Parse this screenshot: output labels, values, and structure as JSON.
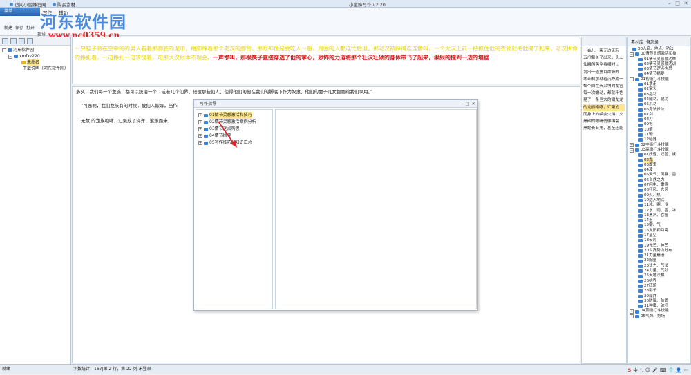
{
  "titlebar": {
    "link1": "访问小蜜蜂官网",
    "link2": "购买素材",
    "app_title": "小蜜蜂写作 v2.20"
  },
  "ribbon": {
    "orb": "菜单",
    "tabs": [
      "写作",
      "辅助"
    ],
    "buttons": [
      "新建",
      "保存",
      "打开",
      "指导"
    ]
  },
  "watermark": {
    "title": "河东软件园",
    "url": "www.pc0359.cn"
  },
  "left_tree": {
    "root": "河东软件园",
    "child": "xmfxz220",
    "items": [
      "未命名",
      "下载说明（河东软件园）"
    ]
  },
  "top_story": {
    "yellow": "一只鞋子悬在空中的的男人看着那脚底的泥印，用脚踩着那个老汉的脚背，那眼神像是要吃人一般，周围的人都连忙后退，那老汉被踩得连连惨叫，一个大汉上前一把抓住他的衣领就把他提了起来，老汉拼命的挣扎着，一边挣扎一边求饶着，可那大汉根本不理会。",
    "red": "一声惨叫，那根筷子直接穿透了他的掌心，恐怖的力道将那个壮汉壮硕的身体带飞了起来，狠狠的撞到一边的墙壁"
  },
  "main_text": [
    "多久，我们每一个龙族，都可以统治一个，或者几个仙界，较役那些仙人，使得他们匍匐在我们的脚底下作为奴隶，他们的妻子儿女都要给我们享用。”",
    "“可恶啊，我们龙族有的时候，被仙人欺辱，当作",
    "无数 的龙族咆哮，汇聚成了海洋，滚滚而来，"
  ],
  "dialog": {
    "title": "写作指导",
    "items": [
      "01情节灵感激活和技巧",
      "02情节灵感激活案例分析",
      "03情节逻点构思",
      "04情节摘要",
      "05写作技巧和知识汇总"
    ]
  },
  "right_text": [
    "一会儿一柴无边无际",
    "五爪紫长了出来，头上",
    "仙瞬然落全身横衬，。",
    "发出一道震耳欲聋的",
    "寒芒刹那就着沉睁成一",
    "黎个自在天采块的龙宫",
    "每一次蠕动，都就千色",
    "晃了一条巨大的钢龙龙",
    "的龙族咆哮，汇聚成",
    "而身上的鳞会火焰，火",
    "黑砂的眼睛仿佛爆裂",
    "黑蛇长有角，甚至还能"
  ],
  "right_tabs": [
    "素材库",
    "备忘录"
  ],
  "right_tree": [
    "00人名、地点、功法",
    "00情节灵感激活和技",
    "01情节灵感激活举",
    "02情节灵感激活训",
    "03情节逻点构思",
    "04情节摘要",
    "01初级打斗技能",
    "01拿走",
    "02掌头",
    "03指功",
    "04腿功、腿功",
    "05爪功",
    "06身法步法",
    "07剑",
    "08刀",
    "09枪",
    "10箭",
    "11鞭",
    "12暗器",
    "02中级打斗技能",
    "03高级打斗技能",
    "01妖怪、妖兽、妖",
    "02龙",
    "03魔鬼",
    "04凌",
    "05天气、风暴、雷",
    "06自然之力",
    "07闪电、雷霆",
    "08狂风、大风",
    "09火、热",
    "10结入地底",
    "11冰、寒、冷",
    "12水、雨、雪、冰",
    "13黑洞、吞噬",
    "14土",
    "15雾、气",
    "16太阳和月亮",
    "17星空",
    "18云彩",
    "19光芒、神芒",
    "20世界势力分布",
    "21力量崩溃",
    "22配量",
    "23法力、气法",
    "24力量、气劲",
    "25天地法相",
    "26结界",
    "27阵场",
    "28影子",
    "29爆炸",
    "30防御、防盾",
    "31种魔、破坏",
    "04顶级打斗技能",
    "05气势、势场"
  ],
  "status": {
    "left": "就绪",
    "stats": "字数统计：167|第 2 行，第 22 列|未登录"
  },
  "ime": [
    "S",
    "中",
    "°,",
    "☺",
    "🎤",
    "⌨",
    "👕",
    "👤",
    "⋯"
  ]
}
